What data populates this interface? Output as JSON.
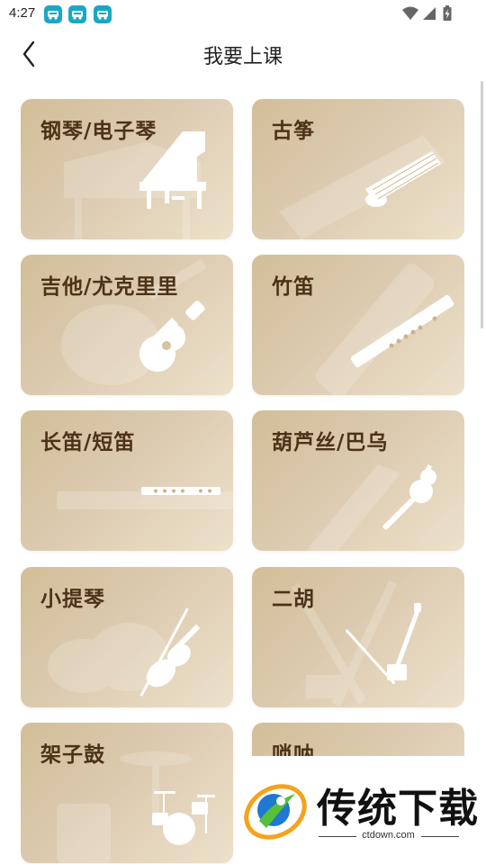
{
  "status_bar": {
    "time": "4:27",
    "notification_icons": [
      "car-app-icon",
      "car-app-icon",
      "car-app-icon"
    ],
    "right_icons": [
      "wifi-icon",
      "cell-signal-icon",
      "battery-charging-icon"
    ]
  },
  "header": {
    "back_icon": "chevron-left-icon",
    "title": "我要上课"
  },
  "instruments": [
    {
      "label": "钢琴/电子琴",
      "icon": "piano-icon"
    },
    {
      "label": "古筝",
      "icon": "guzheng-icon"
    },
    {
      "label": "吉他/尤克里里",
      "icon": "ukulele-icon"
    },
    {
      "label": "竹笛",
      "icon": "bamboo-flute-icon"
    },
    {
      "label": "长笛/短笛",
      "icon": "flute-icon"
    },
    {
      "label": "葫芦丝/巴乌",
      "icon": "hulusi-icon"
    },
    {
      "label": "小提琴",
      "icon": "violin-icon"
    },
    {
      "label": "二胡",
      "icon": "erhu-icon"
    },
    {
      "label": "架子鼓",
      "icon": "drum-kit-icon"
    },
    {
      "label": "唢呐",
      "icon": "suona-icon"
    }
  ],
  "watermark": {
    "brand": "传统下载",
    "url": "ctdown.com"
  },
  "colors": {
    "card_gradient_start": "#d2be97",
    "card_gradient_end": "#ede1ca",
    "label_color": "#4b3218",
    "notification_icon_bg": "#19a7c6"
  }
}
